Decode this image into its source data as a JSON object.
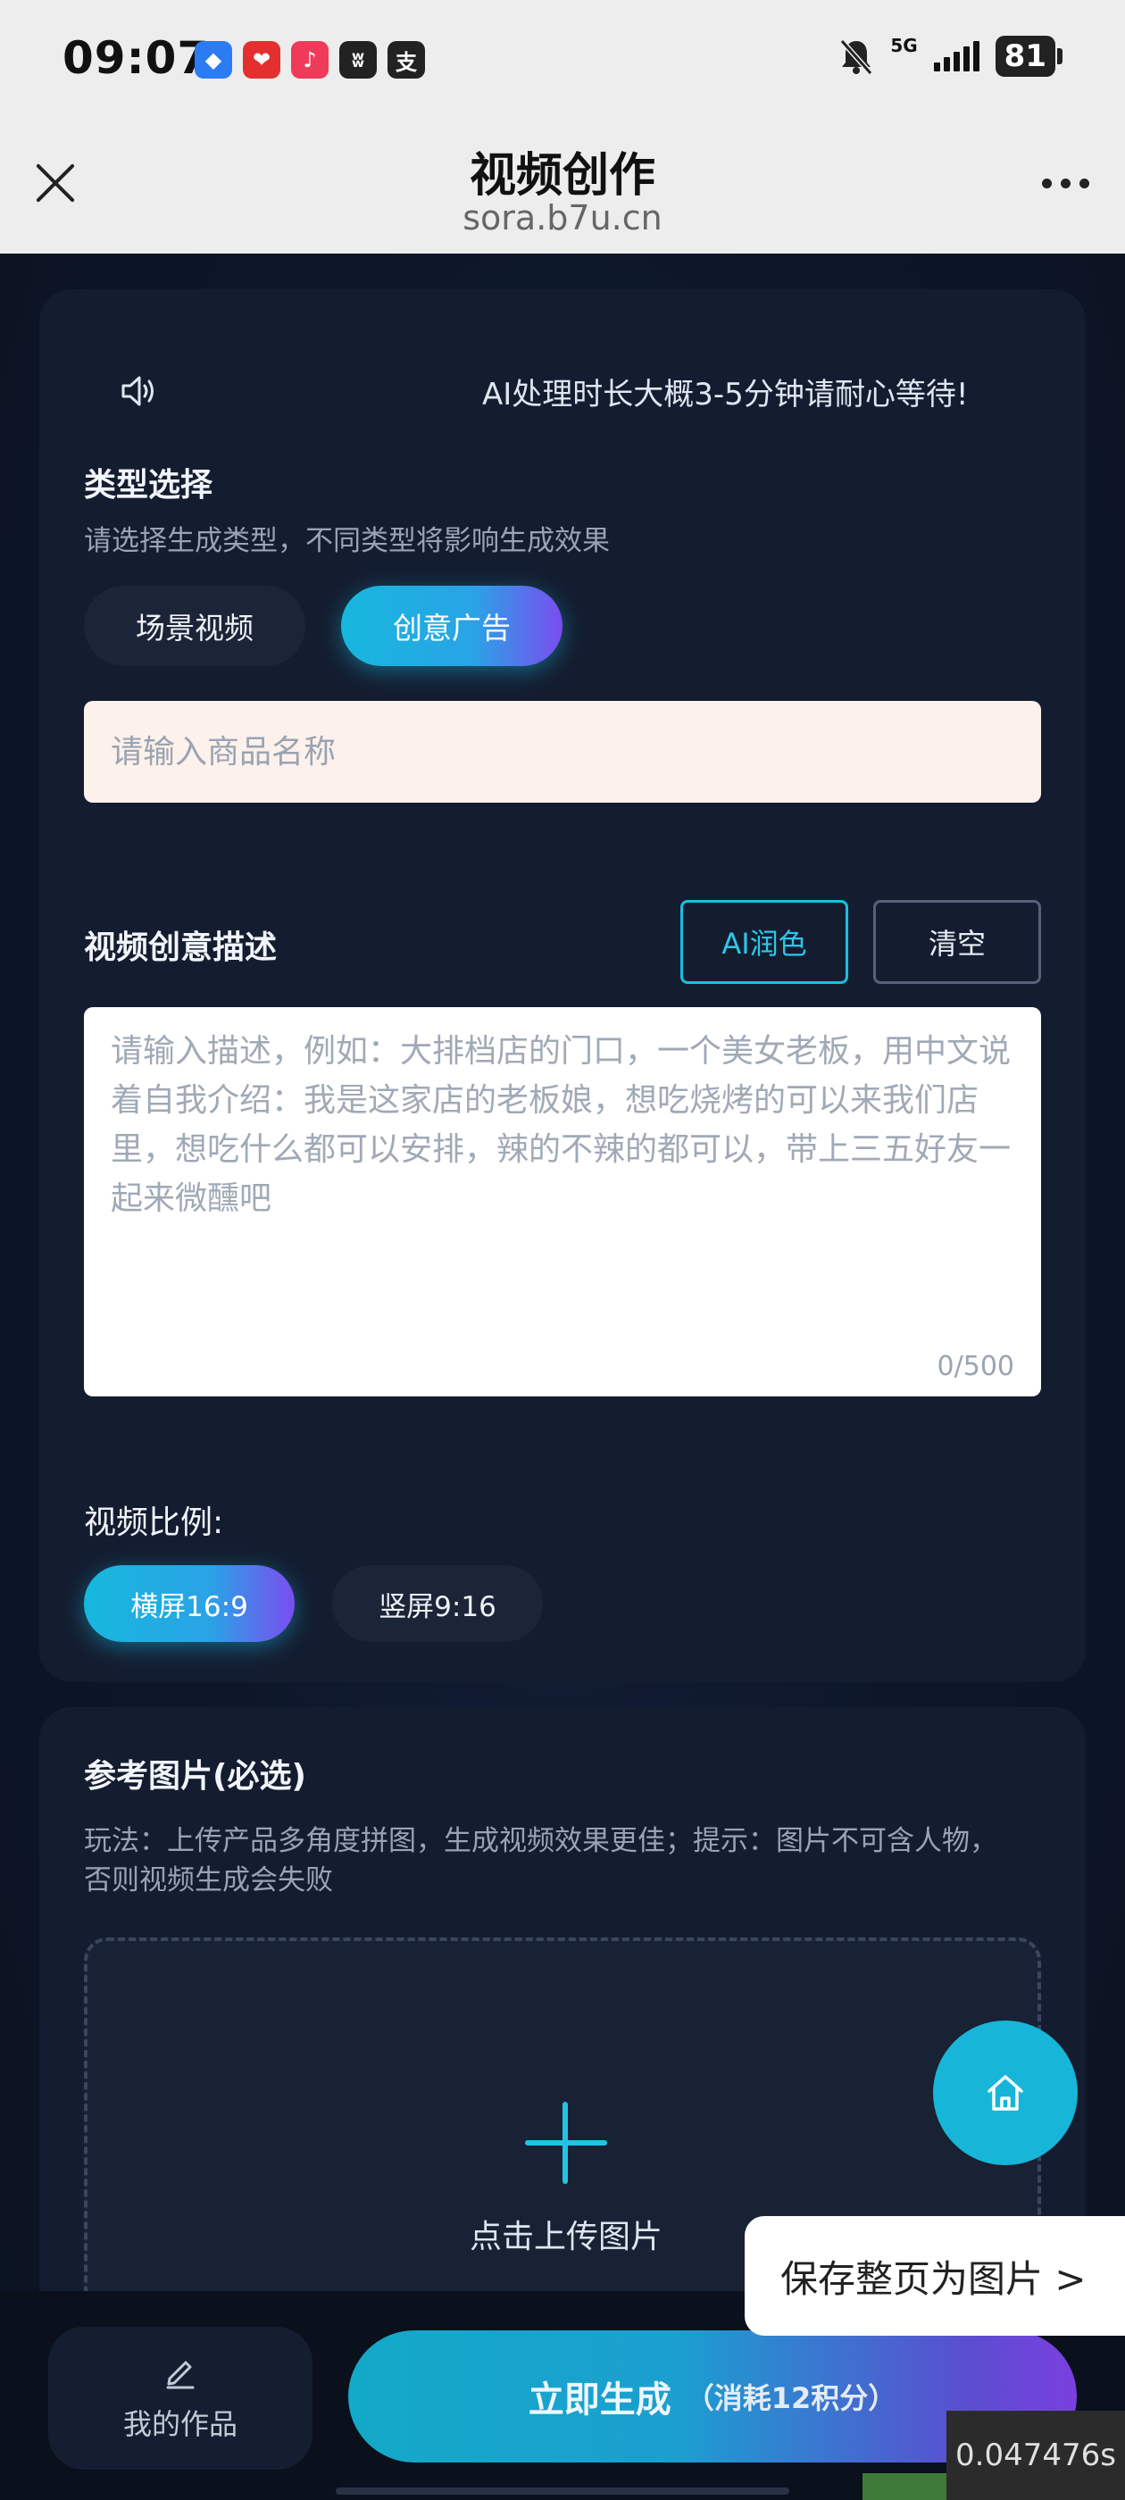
{
  "status_bar": {
    "time": "09:07",
    "network": "5G",
    "battery": "81",
    "app_icons": [
      {
        "name": "cloud-drive-icon",
        "color": "#2b7bf5",
        "glyph": "◆"
      },
      {
        "name": "tmall-icon",
        "color": "#e42f2f",
        "glyph": "❤"
      },
      {
        "name": "douyin-icon",
        "color": "#f03a5a",
        "glyph": "♪"
      },
      {
        "name": "weibo-icon",
        "color": "#222222",
        "glyph": "ʬ"
      },
      {
        "name": "alipay-icon",
        "color": "#222222",
        "glyph": "支"
      }
    ]
  },
  "title_bar": {
    "title": "视频创作",
    "url": "sora.b7u.cn"
  },
  "notice": {
    "text": "AI处理时长大概3-5分钟请耐心等待!"
  },
  "type_section": {
    "title": "类型选择",
    "hint": "请选择生成类型，不同类型将影响生成效果",
    "options": [
      "场景视频",
      "创意广告"
    ],
    "selected": "创意广告"
  },
  "product_input": {
    "placeholder": "请输入商品名称",
    "value": ""
  },
  "description": {
    "title": "视频创意描述",
    "ai_button": "AI润色",
    "clear_button": "清空",
    "placeholder": "请输入描述，例如：大排档店的门口，一个美女老板，用中文说着自我介绍：我是这家店的老板娘，想吃烧烤的可以来我们店里，想吃什么都可以安排，辣的不辣的都可以，带上三五好友一起来微醺吧",
    "value": "",
    "char_count": "0/500"
  },
  "ratio": {
    "title": "视频比例:",
    "options": [
      "横屏16:9",
      "竖屏9:16"
    ],
    "selected": "横屏16:9"
  },
  "reference": {
    "title": "参考图片(必选)",
    "hint_line1": "玩法：上传产品多角度拼图，生成视频效果更佳；提示：图片不可含人物，",
    "hint_line2": "否则视频生成会失败",
    "upload_label": "点击上传图片"
  },
  "save_toast": {
    "label": "保存整页为图片 >"
  },
  "bottom": {
    "works_label": "我的作品",
    "generate_label": "立即生成",
    "generate_cost": "（消耗12积分）"
  },
  "timer": "0.047476s",
  "colors": {
    "accent": "#17b6d8",
    "accent_purple": "#7a4df0",
    "background": "#0c1424",
    "card": "#141d30"
  }
}
